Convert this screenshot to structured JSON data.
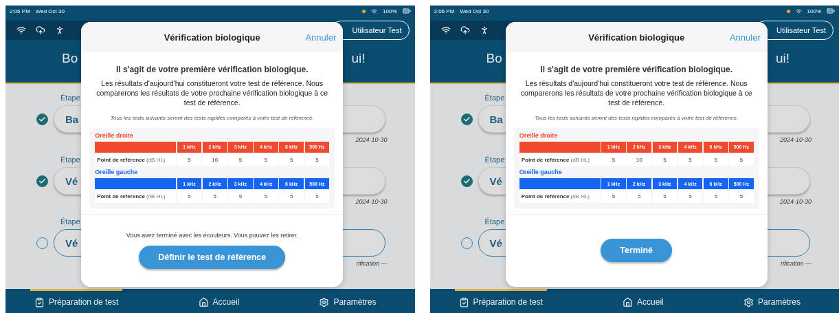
{
  "screens": [
    {
      "status_bar": {
        "time": "2:06 PM",
        "date": "Wed Oct 30",
        "battery": "100%"
      },
      "header": {
        "user_button": "Utilisateur Test",
        "greeting_start": "Bo",
        "greeting_end": "ui!"
      },
      "steps": [
        {
          "label": "Étape",
          "button": "Ba",
          "done": true,
          "note": "2024-10-30"
        },
        {
          "label": "Étape",
          "button": "Vé",
          "done": true,
          "note": "2024-10-30"
        },
        {
          "label": "Étape",
          "button": "Vé",
          "done": false,
          "note": "rification —"
        }
      ],
      "nav": [
        {
          "label": "Préparation de test",
          "selected": true
        },
        {
          "label": "Accueil",
          "selected": false
        },
        {
          "label": "Paramètres",
          "selected": false
        }
      ],
      "dialog": {
        "title": "Vérification biologique",
        "cancel": "Annuler",
        "heading": "Il s'agit de votre première vérification biologique.",
        "body": "Les résultats d'aujourd'hui constitueront votre test de référence. Nous comparerons les résultats de votre prochaine vérification biologique à ce test de référence.",
        "note": "Tous les tests suivants seront des tests rapides comparés à votre test de référence.",
        "ears": [
          {
            "title": "Oreille droite",
            "color": "#f04a2f",
            "columns": [
              "1 kHz",
              "2 kHz",
              "3 kHz",
              "4 kHz",
              "6 kHz",
              "500 Hz"
            ],
            "row_label": "Point de référence",
            "row_unit": "(dB HL)",
            "values": [
              "5",
              "10",
              "5",
              "5",
              "5",
              "5"
            ]
          },
          {
            "title": "Oreille gauche",
            "color": "#1565f2",
            "columns": [
              "1 kHz",
              "2 kHz",
              "3 kHz",
              "4 kHz",
              "6 kHz",
              "500 Hz"
            ],
            "row_label": "Point de référence",
            "row_unit": "(dB HL)",
            "values": [
              "5",
              "5",
              "5",
              "5",
              "5",
              "5"
            ]
          }
        ],
        "footer_note": "Vous avez terminé avec les écouteurs. Vous pouvez les retirer.",
        "action": "Définir le test de référence"
      }
    },
    {
      "status_bar": {
        "time": "2:06 PM",
        "date": "Wed Oct 30",
        "battery": "100%"
      },
      "header": {
        "user_button": "Utilisateur Test",
        "greeting_start": "Bo",
        "greeting_end": "ui!"
      },
      "steps": [
        {
          "label": "Étape",
          "button": "Ba",
          "done": true,
          "note": "2024-10-30"
        },
        {
          "label": "Étape",
          "button": "Vé",
          "done": true,
          "note": "2024-10-30"
        },
        {
          "label": "Étape",
          "button": "Vé",
          "done": false,
          "note": "rification —"
        }
      ],
      "nav": [
        {
          "label": "Préparation de test",
          "selected": true
        },
        {
          "label": "Accueil",
          "selected": false
        },
        {
          "label": "Paramètres",
          "selected": false
        }
      ],
      "dialog": {
        "title": "Vérification biologique",
        "cancel": "Annuler",
        "heading": "Il s'agit de votre première vérification biologique.",
        "body": "Les résultats d'aujourd'hui constitueront votre test de référence. Nous comparerons les résultats de votre prochaine vérification biologique à ce test de référence.",
        "note": "Tous les tests suivants seront des tests rapides comparés à votre test de référence.",
        "ears": [
          {
            "title": "Oreille droite",
            "color": "#f04a2f",
            "columns": [
              "1 kHz",
              "2 kHz",
              "3 kHz",
              "4 kHz",
              "6 kHz",
              "500 Hz"
            ],
            "row_label": "Point de référence",
            "row_unit": "(dB HL)",
            "values": [
              "5",
              "10",
              "5",
              "5",
              "5",
              "5"
            ]
          },
          {
            "title": "Oreille gauche",
            "color": "#1565f2",
            "columns": [
              "1 kHz",
              "2 kHz",
              "3 kHz",
              "4 kHz",
              "6 kHz",
              "500 Hz"
            ],
            "row_label": "Point de référence",
            "row_unit": "(dB HL)",
            "values": [
              "5",
              "5",
              "5",
              "5",
              "5",
              "5"
            ]
          }
        ],
        "action": "Terminé"
      }
    }
  ]
}
